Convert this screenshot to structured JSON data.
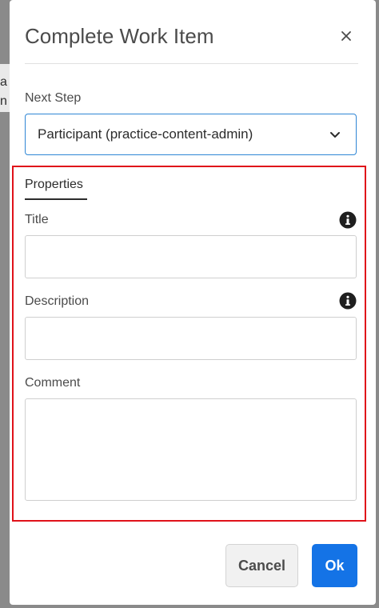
{
  "backdrop": {
    "text_line1": "a",
    "text_line2": "n"
  },
  "dialog": {
    "title": "Complete Work Item",
    "close_icon": "close-icon",
    "next_step_label": "Next Step",
    "next_step_value": "Participant (practice-content-admin)",
    "tab_label": "Properties",
    "title_label": "Title",
    "title_value": "",
    "description_label": "Description",
    "description_value": "",
    "comment_label": "Comment",
    "comment_value": "",
    "cancel_label": "Cancel",
    "ok_label": "Ok",
    "colors": {
      "primary": "#1473e6",
      "highlight_border": "#e0121a",
      "focus_border": "#2f86d5"
    }
  }
}
